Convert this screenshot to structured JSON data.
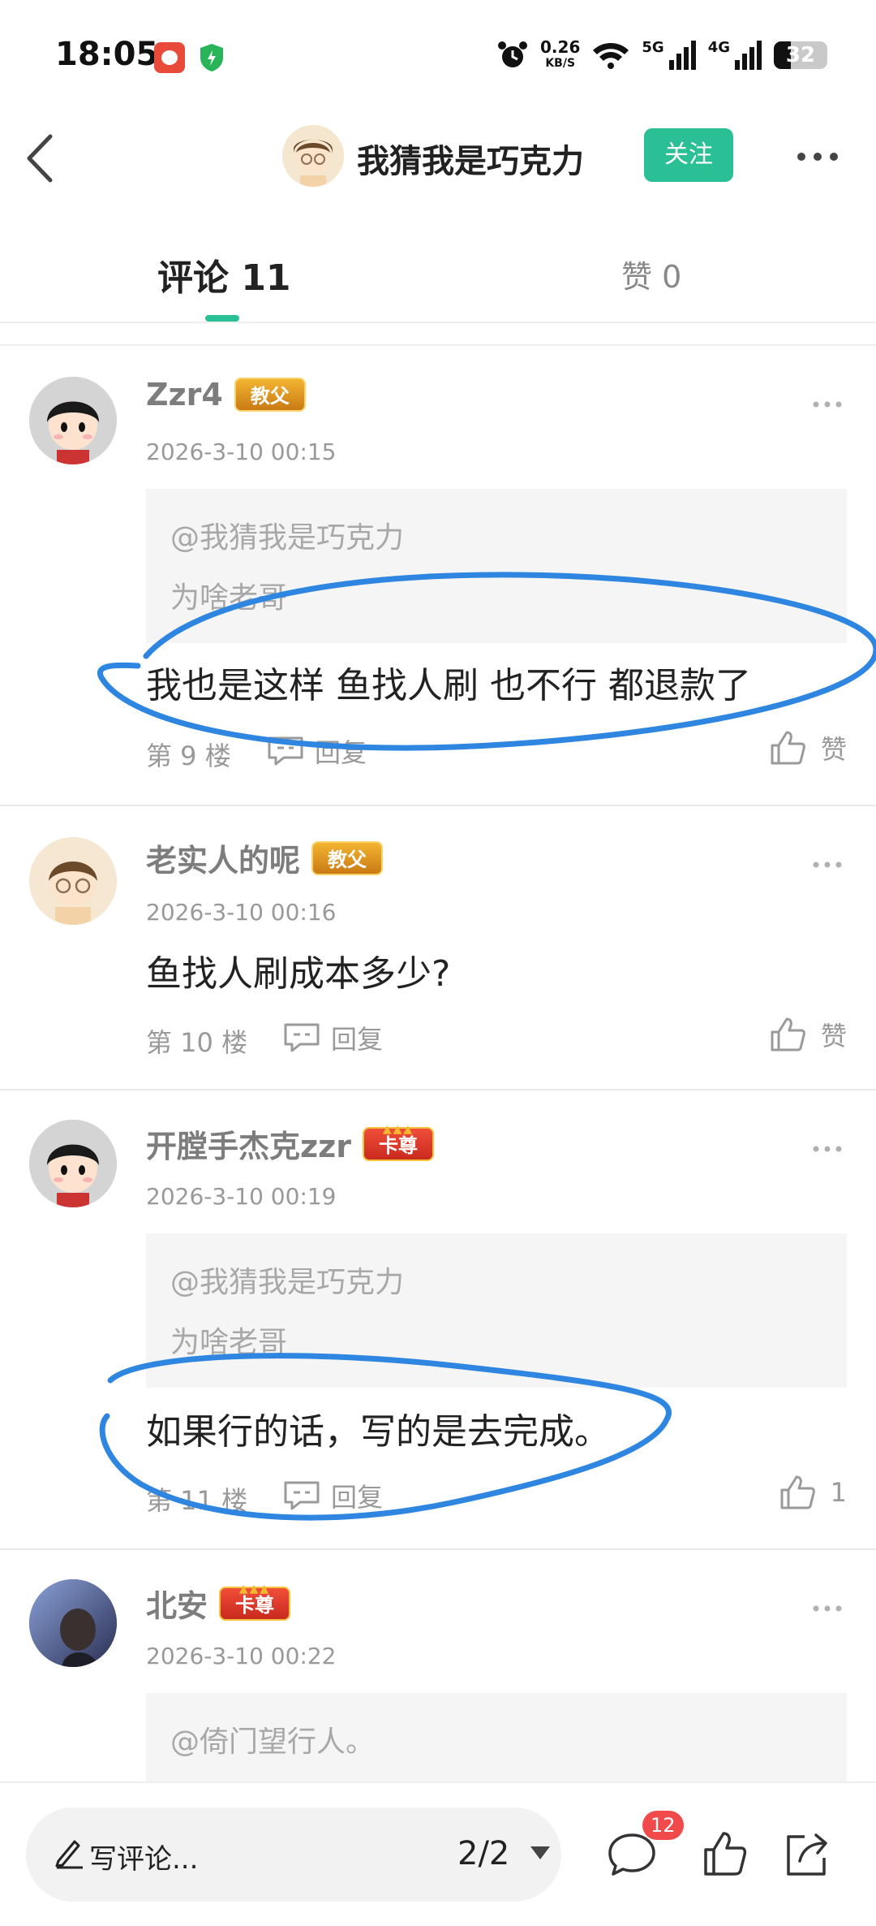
{
  "status_bar": {
    "time": "18:05",
    "net_speed_value": "0.26",
    "net_speed_unit": "KB/S",
    "signal1_label": "5G",
    "signal2_label": "4G",
    "battery": "32",
    "battery_level": 0.32
  },
  "header": {
    "title": "我猜我是巧克力",
    "follow_label": "关注"
  },
  "tabs": {
    "comments_label": "评论 11",
    "likes_label": "赞 0"
  },
  "comments": [
    {
      "user": "Zzr4",
      "badge": "教父",
      "time": "2026-3-10 00:15",
      "quote_user": "@我猜我是巧克力",
      "quote_text": "为啥老哥",
      "text": "我也是这样 鱼找人刷 也不行 都退款了",
      "floor": "第 9 楼",
      "reply_label": "回复",
      "like_label": "赞"
    },
    {
      "user": "老实人的呢",
      "badge": "教父",
      "time": "2026-3-10 00:16",
      "text": "鱼找人刷成本多少?",
      "floor": "第 10 楼",
      "reply_label": "回复",
      "like_label": "赞"
    },
    {
      "user": "开膛手杰克zzr",
      "badge": "卡尊",
      "time": "2026-3-10 00:19",
      "quote_user": "@我猜我是巧克力",
      "quote_text": "为啥老哥",
      "text": "如果行的话，写的是去完成。",
      "floor": "第 11 楼",
      "reply_label": "回复",
      "like_label": "1"
    },
    {
      "user": "北安",
      "badge": "卡尊",
      "time": "2026-3-10 00:22",
      "quote_user": "@倚门望行人。"
    }
  ],
  "bottom_bar": {
    "write_label": "写评论...",
    "page_indicator": "2/2",
    "comment_count": "12"
  },
  "colors": {
    "accent": "#2bbf96",
    "annotation": "#2f86e0",
    "badge_notification": "#f04a4a"
  }
}
